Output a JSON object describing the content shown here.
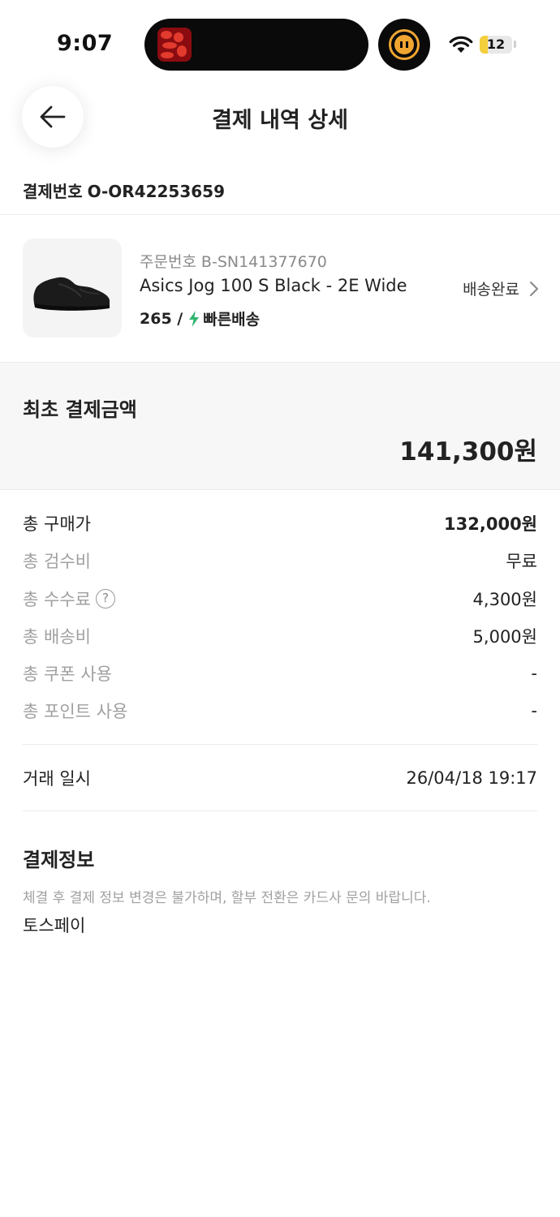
{
  "status_bar": {
    "time": "9:07",
    "battery": "12",
    "battery_level": 0.12
  },
  "header": {
    "title": "결제 내역 상세",
    "back_icon": "arrow-left-icon"
  },
  "payment_number": {
    "label": "결제번호",
    "value": "O-OR42253659"
  },
  "product": {
    "order_label": "주문번호",
    "order_number": "B-SN141377670",
    "name": "Asics Jog 100 S Black - 2E Wide",
    "size": "265 /",
    "shipping_badge": "빠른배송",
    "status": "배송완료",
    "image_icon": "sneaker-image"
  },
  "total": {
    "label": "최초 결제금액",
    "amount": "141,300원"
  },
  "breakdown": [
    {
      "label": "총 구매가",
      "value": "132,000원"
    },
    {
      "label": "총 검수비",
      "value": "무료"
    },
    {
      "label": "총 수수료",
      "value": "4,300원"
    },
    {
      "label": "총 배송비",
      "value": "5,000원"
    },
    {
      "label": "총 쿠폰 사용",
      "value": "-"
    },
    {
      "label": "총 포인트 사용",
      "value": "-"
    }
  ],
  "transaction": {
    "label": "거래 일시",
    "value": "26/04/18 19:17"
  },
  "payment_info": {
    "title": "결제정보",
    "note": "체결 후 결제 정보 변경은 불가하며, 할부 전환은 카드사 문의 바랍니다.",
    "method": "토스페이"
  },
  "colors": {
    "bolt": "#31b46e",
    "battery_fill": "#f4cf3c",
    "timer": "#f0a531"
  }
}
